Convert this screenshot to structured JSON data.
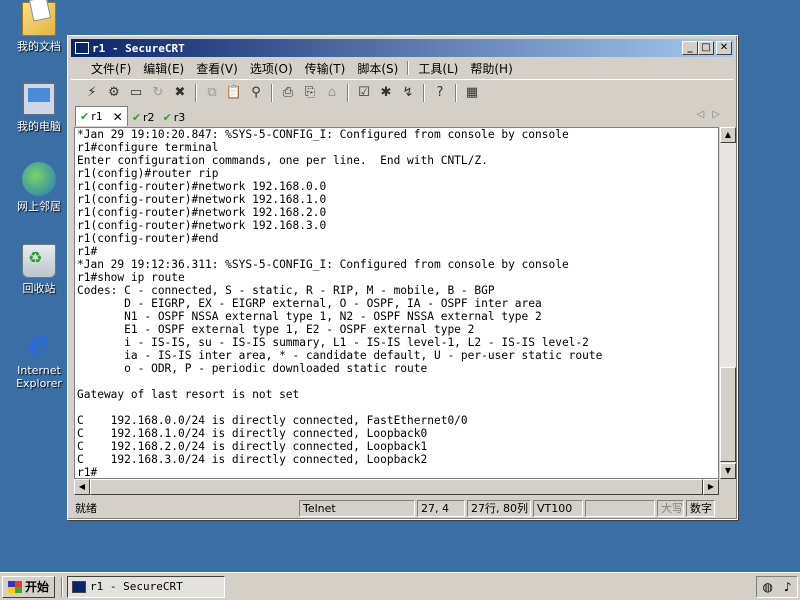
{
  "desktop": {
    "icons": [
      {
        "label": "我的文档",
        "icon": "my-documents-icon"
      },
      {
        "label": "我的电脑",
        "icon": "my-computer-icon"
      },
      {
        "label": "网上邻居",
        "icon": "network-places-icon"
      },
      {
        "label": "回收站",
        "icon": "recycle-bin-icon"
      },
      {
        "label": "Internet Explorer",
        "icon": "internet-explorer-icon"
      }
    ]
  },
  "window": {
    "title": "r1 - SecureCRT",
    "controls": {
      "minimize": "_",
      "maximize": "□",
      "close": "✕"
    },
    "menu": [
      "文件(F)",
      "编辑(E)",
      "查看(V)",
      "选项(O)",
      "传输(T)",
      "脚本(S)",
      "工具(L)",
      "帮助(H)"
    ],
    "tabs": [
      {
        "label": "r1",
        "active": true,
        "close": "✕"
      },
      {
        "label": "r2",
        "active": false
      },
      {
        "label": "r3",
        "active": false
      }
    ],
    "tab_scroll": {
      "left": "◁",
      "right": "▷"
    }
  },
  "terminal": {
    "lines": [
      "*Jan 29 19:10:20.847: %SYS-5-CONFIG_I: Configured from console by console",
      "r1#configure terminal",
      "Enter configuration commands, one per line.  End with CNTL/Z.",
      "r1(config)#router rip",
      "r1(config-router)#network 192.168.0.0",
      "r1(config-router)#network 192.168.1.0",
      "r1(config-router)#network 192.168.2.0",
      "r1(config-router)#network 192.168.3.0",
      "r1(config-router)#end",
      "r1#",
      "*Jan 29 19:12:36.311: %SYS-5-CONFIG_I: Configured from console by console",
      "r1#show ip route",
      "Codes: C - connected, S - static, R - RIP, M - mobile, B - BGP",
      "       D - EIGRP, EX - EIGRP external, O - OSPF, IA - OSPF inter area",
      "       N1 - OSPF NSSA external type 1, N2 - OSPF NSSA external type 2",
      "       E1 - OSPF external type 1, E2 - OSPF external type 2",
      "       i - IS-IS, su - IS-IS summary, L1 - IS-IS level-1, L2 - IS-IS level-2",
      "       ia - IS-IS inter area, * - candidate default, U - per-user static route",
      "       o - ODR, P - periodic downloaded static route",
      "",
      "Gateway of last resort is not set",
      "",
      "C    192.168.0.0/24 is directly connected, FastEthernet0/0",
      "C    192.168.1.0/24 is directly connected, Loopback0",
      "C    192.168.2.0/24 is directly connected, Loopback1",
      "C    192.168.3.0/24 is directly connected, Loopback2",
      "r1#"
    ]
  },
  "scroll": {
    "up": "▲",
    "down": "▼",
    "left": "◀",
    "right": "▶"
  },
  "status": {
    "ready": "就绪",
    "protocol": "Telnet",
    "cursor": "27,  4",
    "dimensions": "27行, 80列",
    "emulation": "VT100",
    "blank": "",
    "caps": "大写",
    "num": "数字"
  },
  "taskbar": {
    "start_label": "开始",
    "task_label": "r1 - SecureCRT"
  }
}
